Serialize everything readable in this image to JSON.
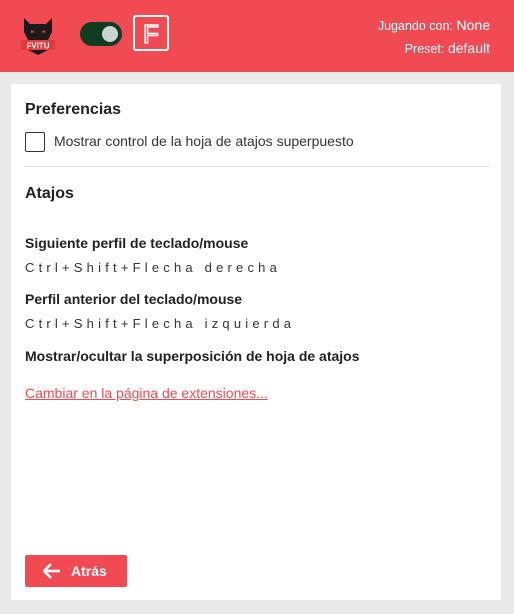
{
  "header": {
    "playing_with_label": "Jugando con:",
    "playing_with_value": "None",
    "preset_label": "Preset:",
    "preset_value": "default",
    "logo_text": "FVITU",
    "toggle_state": "on",
    "f_button_letter": "F"
  },
  "preferences": {
    "title": "Preferencias",
    "overlay_checkbox_label": "Mostrar control de la hoja de atajos superpuesto",
    "overlay_checkbox_checked": false
  },
  "shortcuts": {
    "title": "Atajos",
    "items": [
      {
        "name": "Siguiente perfil de teclado/mouse",
        "keys": "Ctrl+Shift+Flecha derecha"
      },
      {
        "name": "Perfil anterior del teclado/mouse",
        "keys": "Ctrl+Shift+Flecha izquierda"
      },
      {
        "name": "Mostrar/ocultar la superposición de hoja de atajos",
        "keys": ""
      }
    ],
    "change_link": "Cambiar en la página de extensiones..."
  },
  "back_button": {
    "label": "Atrás"
  },
  "colors": {
    "accent": "#f24a52",
    "toggle_on": "#0f3d22",
    "panel": "#ffffff",
    "background": "#e9e9e9"
  }
}
